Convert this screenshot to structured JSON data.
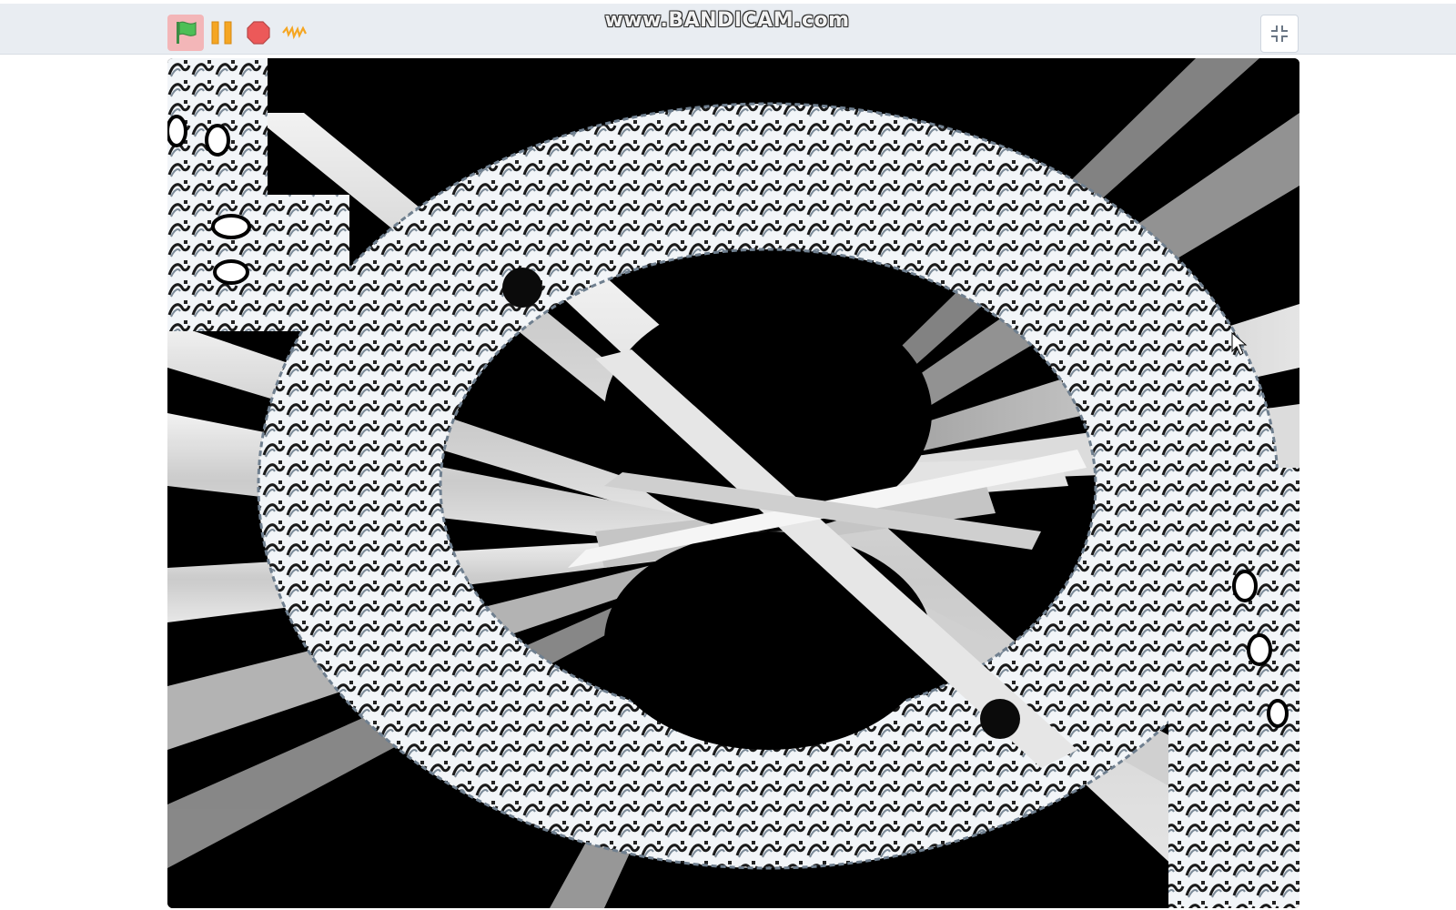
{
  "player": {
    "watermark": "www.BANDICAM.com",
    "controls": {
      "green_flag": "green-flag-icon",
      "pause": "pause-icon",
      "stop": "stop-icon",
      "turbo": "turbo-icon",
      "fullscreen": "exit-fullscreen-icon"
    }
  },
  "colors": {
    "toolbar_bg": "#e9edf2",
    "flag_active_bg": "#f3b6b8",
    "flag_green": "#4cbf56",
    "pause_orange": "#f5a623",
    "stop_red": "#ec5959",
    "stage_bg": "#000000"
  }
}
